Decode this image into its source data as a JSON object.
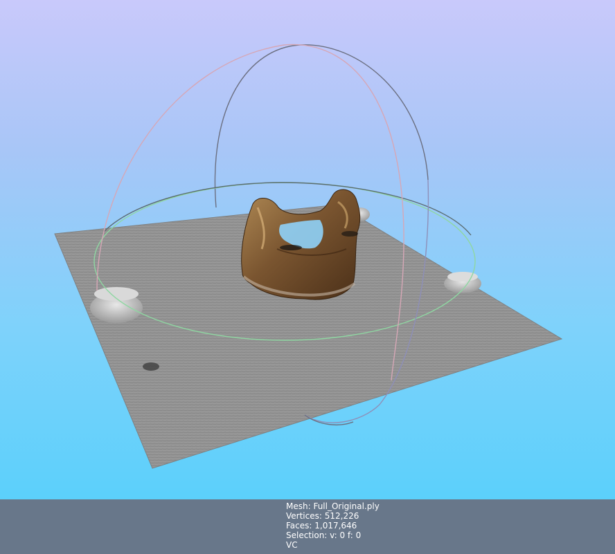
{
  "viewer": {
    "background_top": "#c9c9fb",
    "background_bottom": "#5bd0fb",
    "status_bar_color": "#68778a"
  },
  "scene": {
    "model": "textured-terrain-with-rock-stump",
    "trackball": "visible"
  },
  "info": {
    "mesh": "Mesh: Full_Original.ply",
    "vertices": "Vertices: 512,226",
    "faces": "Faces: 1,017,646",
    "selection": "Selection: v: 0 f: 0",
    "mode": "VC"
  }
}
